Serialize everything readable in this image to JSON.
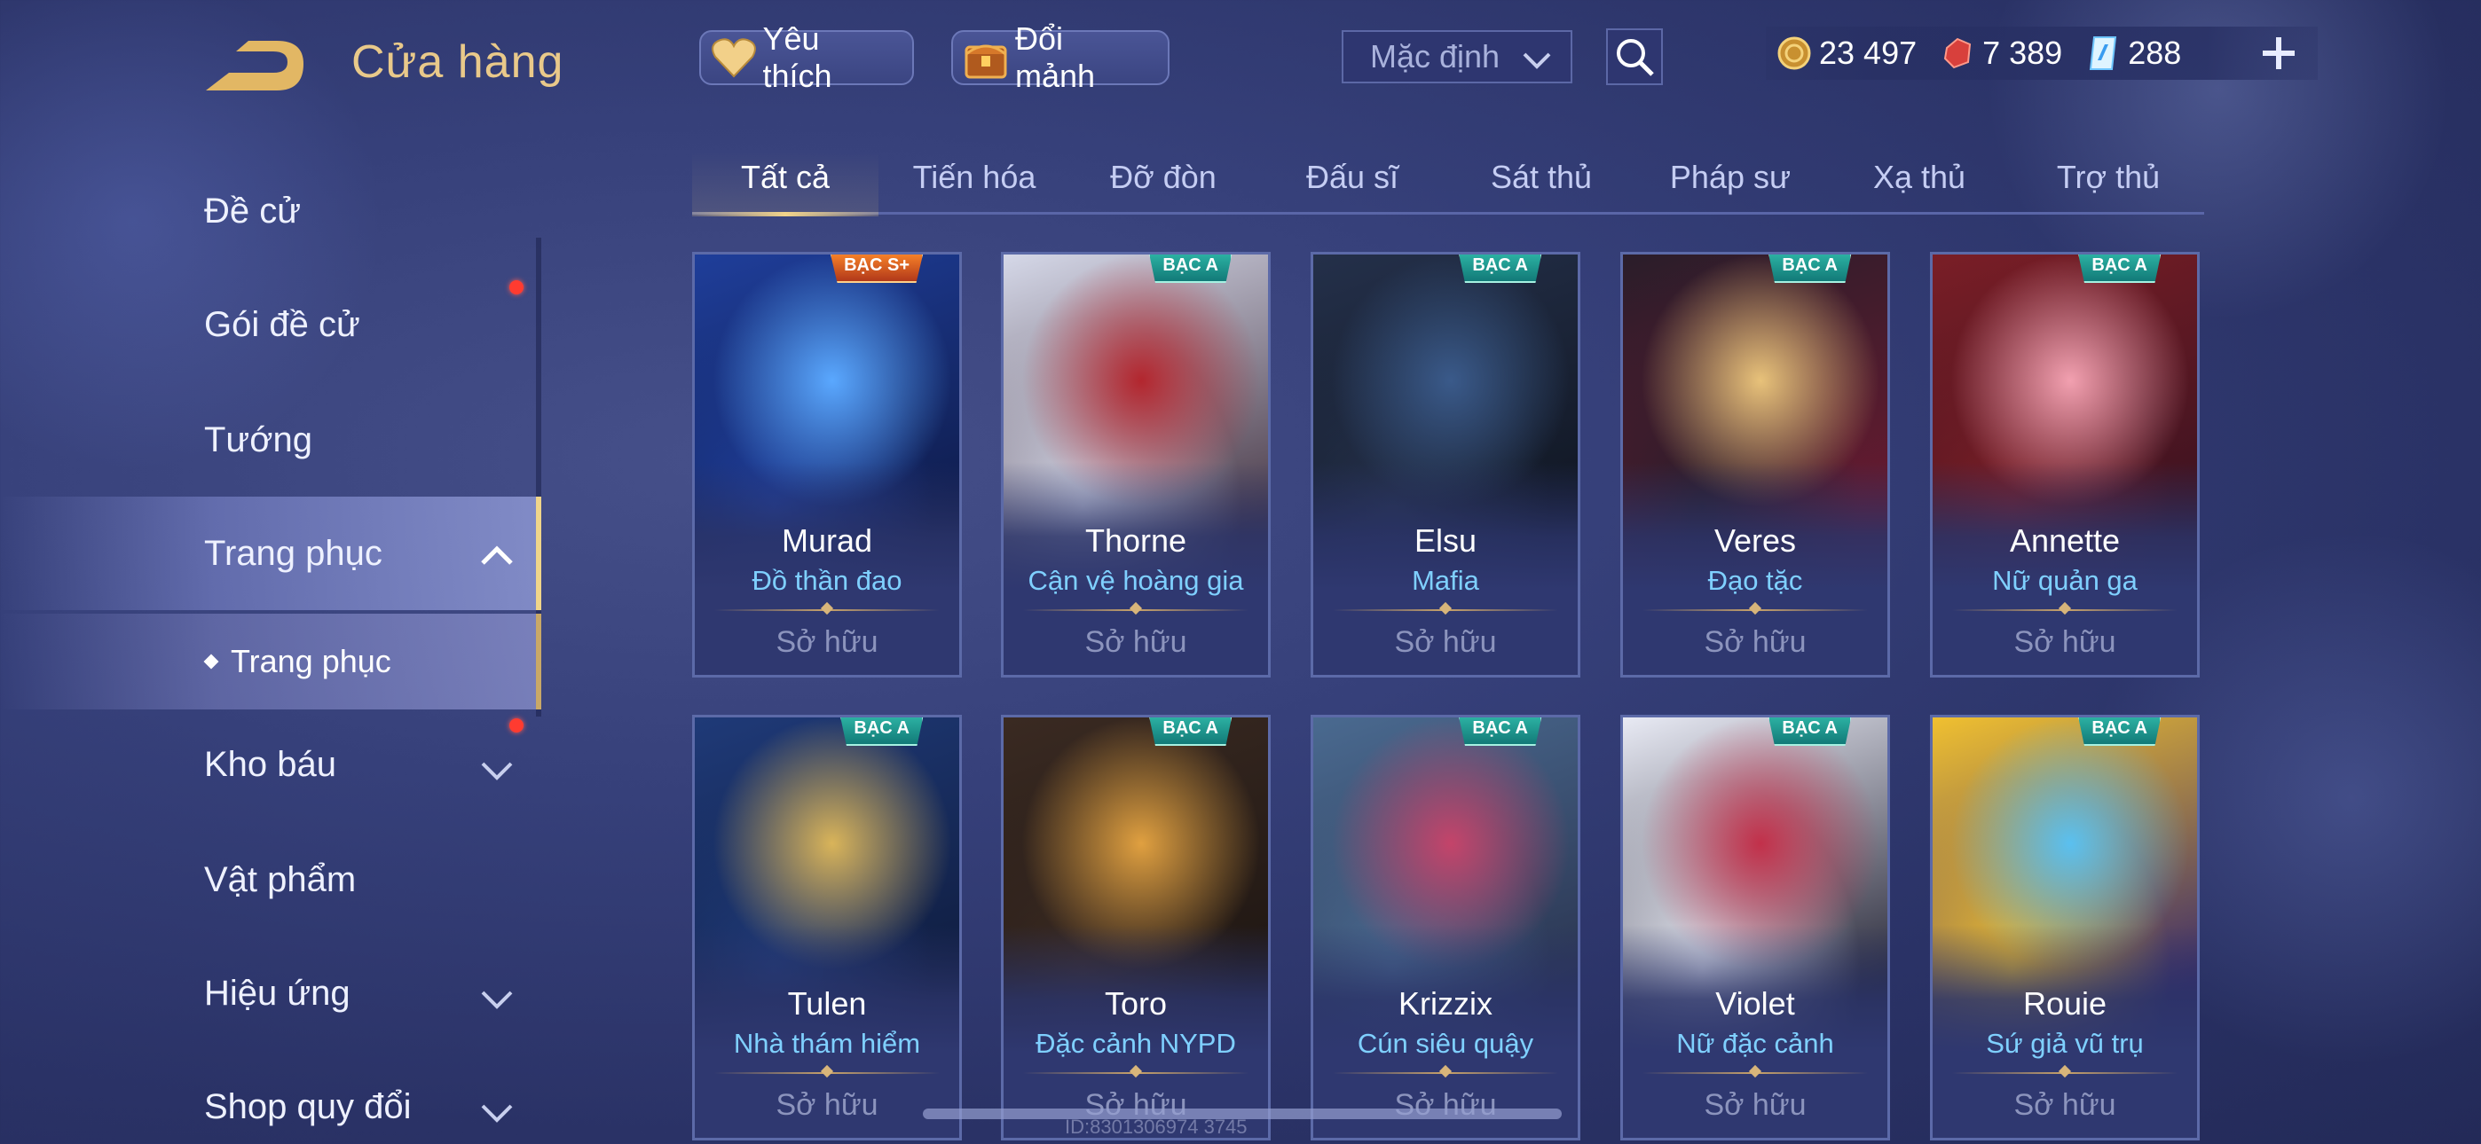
{
  "header": {
    "title": "Cửa hàng",
    "favorite_label": "Yêu thích",
    "exchange_label": "Đổi mảnh",
    "sort_value": "Mặc định",
    "currencies": [
      {
        "name": "gold-coin",
        "value": "23 497",
        "color": "#e0b050"
      },
      {
        "name": "red-gem",
        "value": "7 389",
        "color": "#e05050"
      },
      {
        "name": "blue-voucher",
        "value": "288",
        "color": "#7fd3ff"
      }
    ]
  },
  "sidebar": {
    "items": [
      {
        "label": "Đề cử"
      },
      {
        "label": "Gói đề cử"
      },
      {
        "label": "Tướng"
      },
      {
        "label": "Trang phục"
      },
      {
        "label": "Trang phục"
      },
      {
        "label": "Kho báu"
      },
      {
        "label": "Vật phẩm"
      },
      {
        "label": "Hiệu ứng"
      },
      {
        "label": "Shop quy đổi"
      }
    ]
  },
  "tabs": [
    {
      "label": "Tất cả"
    },
    {
      "label": "Tiến hóa"
    },
    {
      "label": "Đỡ đòn"
    },
    {
      "label": "Đấu sĩ"
    },
    {
      "label": "Sát thủ"
    },
    {
      "label": "Pháp sư"
    },
    {
      "label": "Xạ thủ"
    },
    {
      "label": "Trợ thủ"
    }
  ],
  "skins": [
    {
      "hero": "Murad",
      "skin": "Đồ thần đao",
      "rank": "BẠC S+",
      "status": "Sở hữu",
      "palette": [
        "#1f3e9a",
        "#5aa8ff",
        "#0e1b4a"
      ]
    },
    {
      "hero": "Thorne",
      "skin": "Cận vệ hoàng gia",
      "rank": "BẠC A",
      "status": "Sở hữu",
      "palette": [
        "#d5d8e8",
        "#b3262e",
        "#4a3a48"
      ]
    },
    {
      "hero": "Elsu",
      "skin": "Mafia",
      "rank": "BẠC A",
      "status": "Sở hữu",
      "palette": [
        "#24304a",
        "#3a5a8a",
        "#101622"
      ]
    },
    {
      "hero": "Veres",
      "skin": "Đạo tặc",
      "rank": "BẠC A",
      "status": "Sở hữu",
      "palette": [
        "#2a1d2a",
        "#e8c27a",
        "#6a1a30"
      ]
    },
    {
      "hero": "Annette",
      "skin": "Nữ quản ga",
      "rank": "BẠC A",
      "status": "Sở hữu",
      "palette": [
        "#7a1e26",
        "#f2a0b0",
        "#3a1220"
      ]
    },
    {
      "hero": "Tulen",
      "skin": "Nhà thám hiểm",
      "rank": "BẠC A",
      "status": "Sở hữu",
      "palette": [
        "#1f3a78",
        "#d9b45a",
        "#0f1c3e"
      ]
    },
    {
      "hero": "Toro",
      "skin": "Đặc cảnh NYPD",
      "rank": "BẠC A",
      "status": "Sở hữu",
      "palette": [
        "#3a2a22",
        "#e0a040",
        "#1e1612"
      ]
    },
    {
      "hero": "Krizzix",
      "skin": "Cún siêu quậy",
      "rank": "BẠC A",
      "status": "Sở hữu",
      "palette": [
        "#4a6a90",
        "#c4446a",
        "#2a3450"
      ]
    },
    {
      "hero": "Violet",
      "skin": "Nữ đặc cảnh",
      "rank": "BẠC A",
      "status": "Sở hữu",
      "palette": [
        "#e8eaf4",
        "#c2304a",
        "#2a2a3a"
      ]
    },
    {
      "hero": "Rouie",
      "skin": "Sứ giả vũ trụ",
      "rank": "BẠC A",
      "status": "Sở hữu",
      "palette": [
        "#f0c030",
        "#5ac0f0",
        "#3a2a6a"
      ]
    }
  ],
  "footer": {
    "uid": "ID:8301306974  3745"
  }
}
